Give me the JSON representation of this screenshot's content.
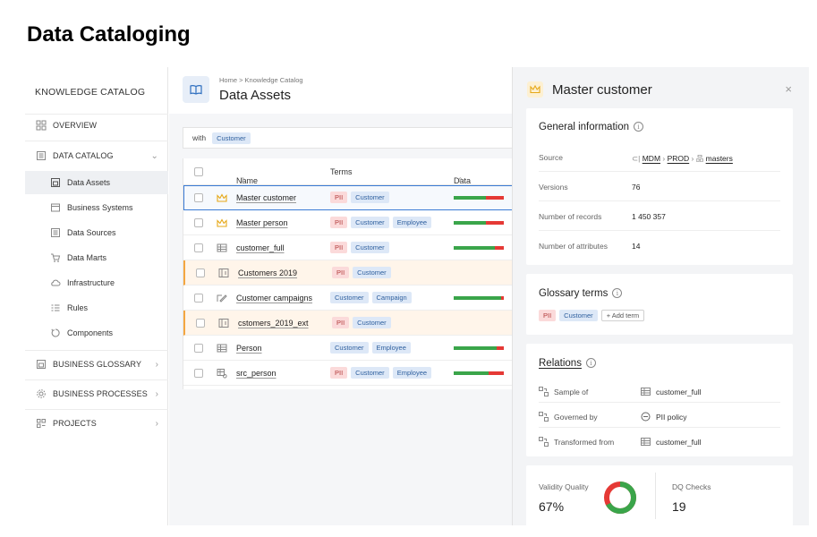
{
  "page": {
    "title": "Data Cataloging"
  },
  "sidebar": {
    "brand": "KNOWLEDGE CATALOG",
    "overview": "OVERVIEW",
    "data_catalog": "DATA CATALOG",
    "sub_items": [
      {
        "label": "Data Assets",
        "icon": "data-assets-icon"
      },
      {
        "label": "Business Systems",
        "icon": "business-systems-icon"
      },
      {
        "label": "Data Sources",
        "icon": "data-sources-icon"
      },
      {
        "label": "Data Marts",
        "icon": "cart-icon"
      },
      {
        "label": "Infrastructure",
        "icon": "cloud-icon"
      },
      {
        "label": "Rules",
        "icon": "rules-icon"
      },
      {
        "label": "Components",
        "icon": "components-icon"
      }
    ],
    "business_glossary": "BUSINESS GLOSSARY",
    "business_processes": "BUSINESS PROCESSES",
    "projects": "PROJECTS",
    "active_item": "Data Assets"
  },
  "header": {
    "breadcrumb": "Home > Knowledge Catalog",
    "title": "Data Assets"
  },
  "filter": {
    "prefix": "with",
    "tag": "Customer"
  },
  "table": {
    "columns": {
      "name": "Name",
      "terms": "Terms",
      "dq": "Data Quality"
    },
    "rows": [
      {
        "name": "Master customer",
        "icon": "crown-icon",
        "terms": [
          "PII",
          "Customer"
        ],
        "dq_good": 0.65,
        "selected": true,
        "flag": false
      },
      {
        "name": "Master person",
        "icon": "crown-icon",
        "terms": [
          "PII",
          "Customer",
          "Employee"
        ],
        "dq_good": 0.65,
        "selected": false,
        "flag": false
      },
      {
        "name": "customer_full",
        "icon": "table-icon",
        "terms": [
          "PII",
          "Customer"
        ],
        "dq_good": 0.82,
        "selected": false,
        "flag": false
      },
      {
        "name": "Customers 2019",
        "icon": "file-icon",
        "terms": [
          "PII",
          "Customer"
        ],
        "dq_good": null,
        "selected": false,
        "flag": true
      },
      {
        "name": "Customer campaigns",
        "icon": "pen-icon",
        "terms": [
          "Customer",
          "Campaign"
        ],
        "dq_good": 0.95,
        "selected": false,
        "flag": false
      },
      {
        "name": "cstomers_2019_ext",
        "icon": "file-icon",
        "terms": [
          "PII",
          "Customer"
        ],
        "dq_good": null,
        "selected": false,
        "flag": true
      },
      {
        "name": "Person",
        "icon": "table-icon",
        "terms": [
          "Customer",
          "Employee"
        ],
        "dq_good": 0.85,
        "selected": false,
        "flag": false
      },
      {
        "name": "src_person",
        "icon": "table-gear-icon",
        "terms": [
          "PII",
          "Customer",
          "Employee"
        ],
        "dq_good": 0.7,
        "selected": false,
        "flag": false
      }
    ]
  },
  "panel": {
    "title": "Master customer",
    "close": "×",
    "general": {
      "title": "General information",
      "source_label": "Source",
      "source_path": [
        "MDM",
        "PROD",
        "masters"
      ],
      "versions_label": "Versions",
      "versions": "76",
      "records_label": "Number of records",
      "records": "1 450 357",
      "attributes_label": "Number of attributes",
      "attributes": "14"
    },
    "glossary": {
      "title": "Glossary terms",
      "terms": [
        "PII",
        "Customer"
      ],
      "add": "+ Add term"
    },
    "relations": {
      "title": "Relations",
      "items": [
        {
          "type": "Sample of",
          "target": "customer_full",
          "target_icon": "table-icon"
        },
        {
          "type": "Governed by",
          "target": "PII policy",
          "target_icon": "policy-icon"
        },
        {
          "type": "Transformed from",
          "target": "customer_full",
          "target_icon": "table-icon"
        }
      ]
    },
    "metrics": {
      "validity_label": "Validity Quality",
      "validity_value": "67%",
      "validity_fraction": 0.67,
      "dq_checks_label": "DQ Checks",
      "dq_checks_value": "19"
    }
  },
  "colors": {
    "good": "#3aa54a",
    "bad": "#e53935",
    "accent": "#3a7bd5",
    "crown": "#e6a817"
  }
}
